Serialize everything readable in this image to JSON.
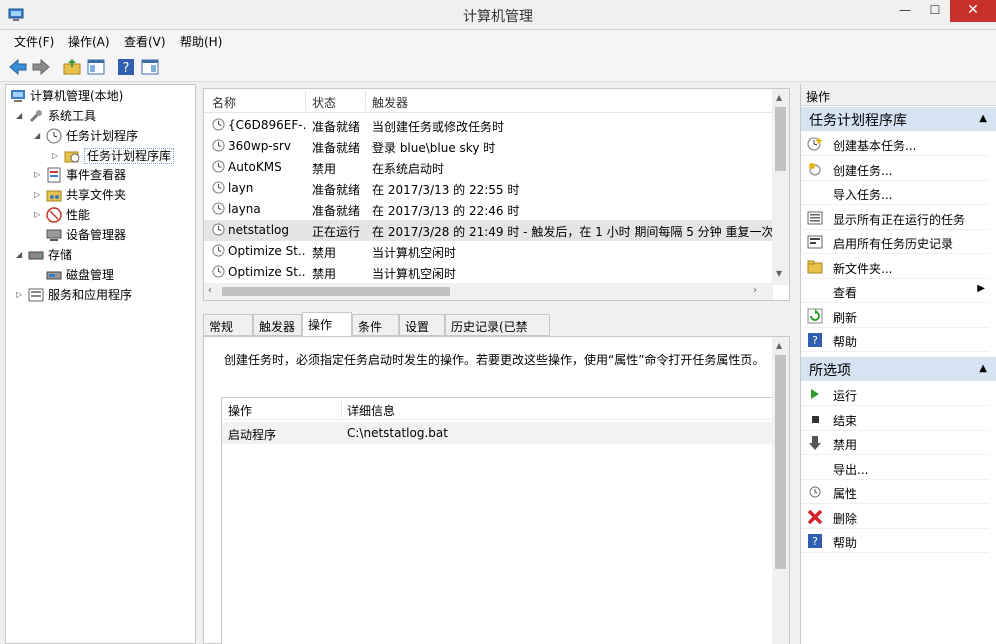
{
  "window": {
    "title": "计算机管理",
    "min": "—",
    "max": "☐",
    "close": "✕"
  },
  "menu": [
    "文件(F)",
    "操作(A)",
    "查看(V)",
    "帮助(H)"
  ],
  "tree": [
    {
      "label": "计算机管理(本地)"
    },
    {
      "label": "系统工具"
    },
    {
      "label": "任务计划程序"
    },
    {
      "label": "任务计划程序库"
    },
    {
      "label": "事件查看器"
    },
    {
      "label": "共享文件夹"
    },
    {
      "label": "性能"
    },
    {
      "label": "设备管理器"
    },
    {
      "label": "存储"
    },
    {
      "label": "磁盘管理"
    },
    {
      "label": "服务和应用程序"
    }
  ],
  "list": {
    "columns": [
      "名称",
      "状态",
      "触发器"
    ],
    "rows": [
      {
        "name": "{C6D896EF-...",
        "status": "准备就绪",
        "trigger": "当创建任务或修改任务时"
      },
      {
        "name": "360wp-srv",
        "status": "准备就绪",
        "trigger": "登录 blue\\blue sky 时"
      },
      {
        "name": "AutoKMS",
        "status": "禁用",
        "trigger": "在系统启动时"
      },
      {
        "name": "layn",
        "status": "准备就绪",
        "trigger": "在 2017/3/13 的 22:55 时"
      },
      {
        "name": "layna",
        "status": "准备就绪",
        "trigger": "在 2017/3/13 的 22:46 时"
      },
      {
        "name": "netstatlog",
        "status": "正在运行",
        "trigger": "在 2017/3/28 的 21:49 时 - 触发后，在 1 小时 期间每隔 5 分钟 重复一次。"
      },
      {
        "name": "Optimize St...",
        "status": "禁用",
        "trigger": "当计算机空闲时"
      },
      {
        "name": "Optimize St...",
        "status": "禁用",
        "trigger": "当计算机空闲时"
      }
    ]
  },
  "tabs": [
    "常规",
    "触发器",
    "操作",
    "条件",
    "设置",
    "历史记录(已禁用)"
  ],
  "detail": {
    "description": "创建任务时，必须指定任务启动时发生的操作。若要更改这些操作，使用“属性”命令打开任务属性页。",
    "columns": [
      "操作",
      "详细信息"
    ],
    "row": {
      "action": "启动程序",
      "detail": "C:\\netstatlog.bat"
    }
  },
  "actions": {
    "title": "操作",
    "section1": "任务计划程序库",
    "items1": [
      "创建基本任务...",
      "创建任务...",
      "导入任务...",
      "显示所有正在运行的任务",
      "启用所有任务历史记录",
      "新文件夹...",
      "查看",
      "刷新",
      "帮助"
    ],
    "section2": "所选项",
    "items2": [
      "运行",
      "结束",
      "禁用",
      "导出...",
      "属性",
      "删除",
      "帮助"
    ]
  },
  "colors": {
    "accent": "#d5e3f2",
    "close": "#c7312a"
  }
}
